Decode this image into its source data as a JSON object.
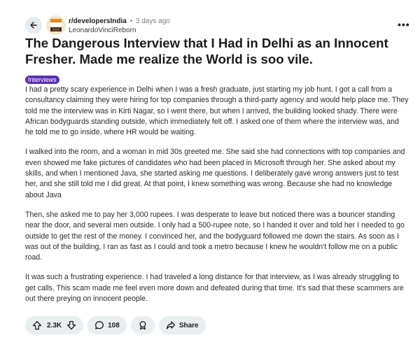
{
  "header": {
    "subreddit": "r/developersIndia",
    "separator": "•",
    "time": "3 days ago",
    "author": "LeonardoVinciReborn",
    "more": "•••"
  },
  "post": {
    "title": "The Dangerous Interview that I Had in Delhi as an Innocent Fresher. Made me realize the World is soo vile.",
    "flair": "Interviews",
    "paragraphs": [
      "I had a pretty scary experience in Delhi when I was a fresh graduate, just starting my job hunt. I got a call from a consultancy claiming they were hiring for top companies through a third-party agency and would help place me. They told me the interview was in Kirti Nagar, so I went there, but when I arrived, the building looked shady. There were African bodyguards standing outside, which immediately felt off. I asked one of them where the interview was, and he told me to go inside, where HR would be waiting.",
      "I walked into the room, and a woman in mid 30s greeted me. She said she had connections with top companies and even showed me fake pictures of candidates who had been placed in Microsoft through her. She asked about my skills, and when I mentioned Java, she started asking me questions. I deliberately gave wrong answers just to test her, and she still told me I did great. At that point, I knew something was wrong. Because she had no knowledge about Java",
      "Then, she asked me to pay her 3,000 rupees. I was desperate to leave but noticed there was a bouncer standing near the door, and several men outside. I only had a 500-rupee note, so I handed it over and told her I needed to go outside to get the rest of the money. I convinced her, and the bodyguard followed me down the stairs. As soon as I was out of the building, I ran as fast as I could and took a metro because I knew he wouldn't follow me on a public road.",
      "It was such a frustrating experience. I had traveled a long distance for that interview, as I was already struggling to get calls. This scam made me feel even more down and defeated during that time. It's sad that these scammers are out there preying on innocent people."
    ]
  },
  "actions": {
    "votes": "2.3K",
    "comments": "108",
    "share": "Share"
  },
  "colors": {
    "flair_bg": "#5a2fb0",
    "pill_bg": "#e9eef0",
    "back_bg": "#e5ebee"
  }
}
